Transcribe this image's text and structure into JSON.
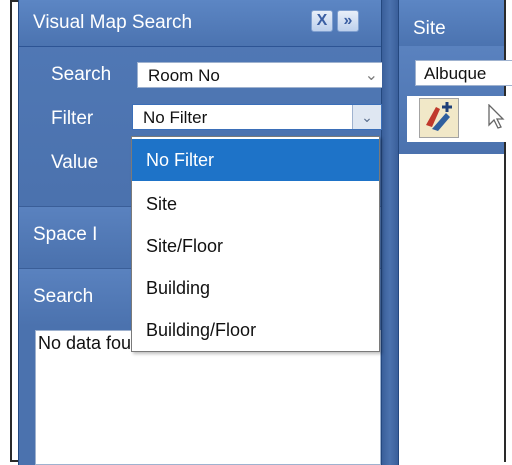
{
  "left_panel": {
    "title": "Visual Map Search",
    "close_glyph": "X",
    "expand_glyph": "»",
    "search": {
      "label": "Search",
      "value": "Room No",
      "chevron": "⌄"
    },
    "filter": {
      "label": "Filter",
      "value": "No Filter",
      "chevron": "⌄"
    },
    "value": {
      "label": "Value"
    },
    "sections": [
      {
        "label": "Space I"
      },
      {
        "label": "Search"
      }
    ],
    "results": {
      "text": "No data found"
    }
  },
  "filter_dropdown": {
    "options": [
      "No Filter",
      "Site",
      "Site/Floor",
      "Building",
      "Building/Floor"
    ],
    "selected": "No Filter"
  },
  "right_panel": {
    "title": "Site",
    "site_value": "Albuque"
  },
  "icons": {
    "close": "close-icon",
    "expand": "double-chevron-right-icon",
    "dropdown": "chevron-down-icon",
    "map_tool": "map-pin-add-icon",
    "pointer": "cursor-arrow-icon"
  },
  "colors": {
    "panel_blue": "#4b72ae",
    "selected_item": "#1e73c8"
  }
}
